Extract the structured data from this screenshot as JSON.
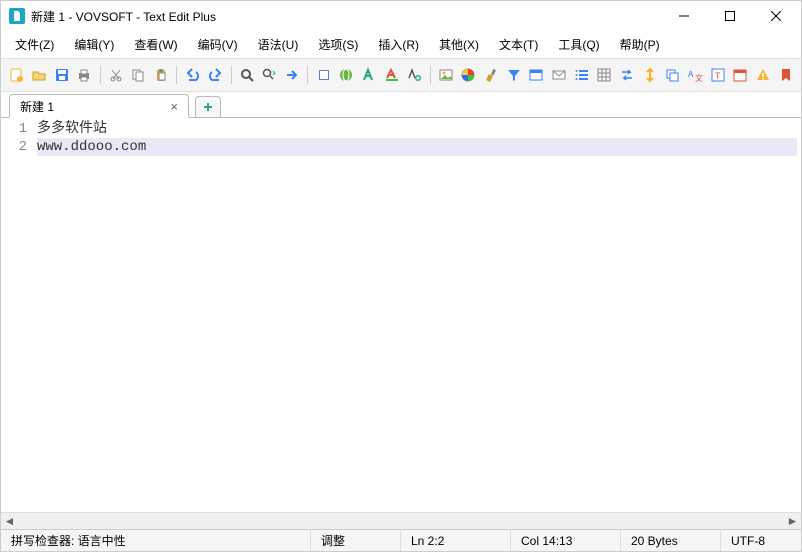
{
  "window": {
    "title": "新建 1 - VOVSOFT - Text Edit Plus"
  },
  "menu": {
    "file": "文件(Z)",
    "edit": "编辑(Y)",
    "view": "查看(W)",
    "encode": "编码(V)",
    "syntax": "语法(U)",
    "options": "选项(S)",
    "insert": "插入(R)",
    "other": "其他(X)",
    "text": "文本(T)",
    "tools": "工具(Q)",
    "help": "帮助(P)"
  },
  "tabs": {
    "active": "新建 1"
  },
  "editor": {
    "lines": [
      "多多软件站",
      "www.ddooo.com"
    ],
    "currentLine": 2
  },
  "statusbar": {
    "spellcheck": "拼写检查器: 语言中性",
    "adjust": "调整",
    "ln": "Ln 2:2",
    "col": "Col 14:13",
    "bytes": "20 Bytes",
    "encoding": "UTF-8"
  },
  "colors": {
    "accent": "#1aa6c4",
    "currentLine": "#e8e8f8"
  }
}
